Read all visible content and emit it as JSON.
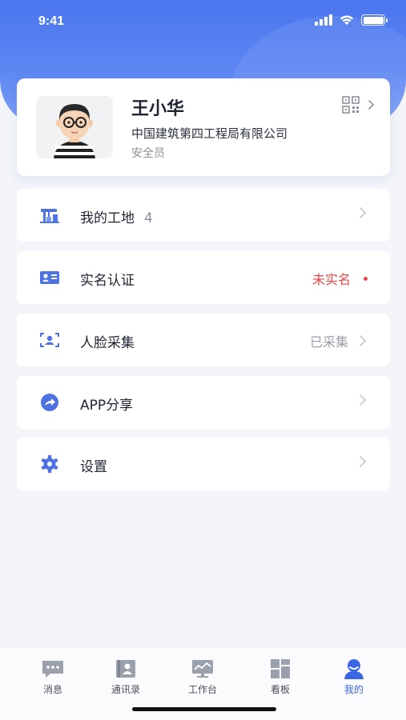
{
  "status_bar": {
    "time": "9:41"
  },
  "profile": {
    "name": "王小华",
    "company": "中国建筑第四工程局有限公司",
    "role": "安全员"
  },
  "menu": [
    {
      "label": "我的工地",
      "count": "4",
      "icon": "construction-site-icon",
      "status": ""
    },
    {
      "label": "实名认证",
      "count": "",
      "icon": "id-card-icon",
      "status": "未实名"
    },
    {
      "label": "人脸采集",
      "count": "",
      "icon": "face-scan-icon",
      "status": "已采集"
    },
    {
      "label": "APP分享",
      "count": "",
      "icon": "share-icon",
      "status": ""
    },
    {
      "label": "设置",
      "count": "",
      "icon": "gear-icon",
      "status": ""
    }
  ],
  "tabbar": [
    {
      "label": "消息",
      "icon": "message-icon"
    },
    {
      "label": "通讯录",
      "icon": "contacts-icon"
    },
    {
      "label": "工作台",
      "icon": "workbench-icon"
    },
    {
      "label": "看板",
      "icon": "dashboard-icon"
    },
    {
      "label": "我的",
      "icon": "profile-icon",
      "active": true
    }
  ],
  "colors": {
    "primary": "#4a76ef",
    "accent_blue": "#3a66e5",
    "icon_blue": "#4f72e3",
    "alert_red": "#e94545",
    "background": "#f3f5f9"
  }
}
